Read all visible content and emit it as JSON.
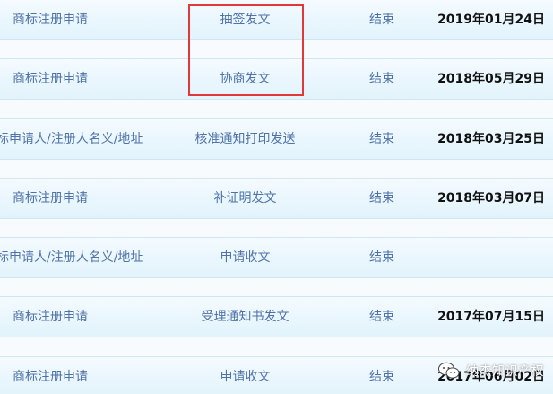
{
  "table": {
    "rows": [
      {
        "type": "商标注册申请",
        "event": "抽签发文",
        "status": "结束",
        "date": "2019年01月24日"
      },
      {
        "type": "商标注册申请",
        "event": "协商发文",
        "status": "结束",
        "date": "2018年05月29日"
      },
      {
        "type": "标申请人/注册人名义/地址",
        "event": "核准通知打印发送",
        "status": "结束",
        "date": "2018年03月25日"
      },
      {
        "type": "商标注册申请",
        "event": "补证明发文",
        "status": "结束",
        "date": "2018年03月07日"
      },
      {
        "type": "标申请人/注册人名义/地址",
        "event": "申请收文",
        "status": "结束",
        "date": ""
      },
      {
        "type": "商标注册申请",
        "event": "受理通知书发文",
        "status": "结束",
        "date": "2017年07月15日"
      },
      {
        "type": "商标注册申请",
        "event": "申请收文",
        "status": "结束",
        "date": "2017年06月02日"
      }
    ]
  },
  "watermark": {
    "text": "纳杰知识产权",
    "icon": "wechat-icon"
  },
  "highlight": {
    "color": "#e0393b"
  },
  "colors": {
    "row_text": "#4f72a8",
    "date_text": "#111111",
    "row_border": "#cfe6f5"
  }
}
